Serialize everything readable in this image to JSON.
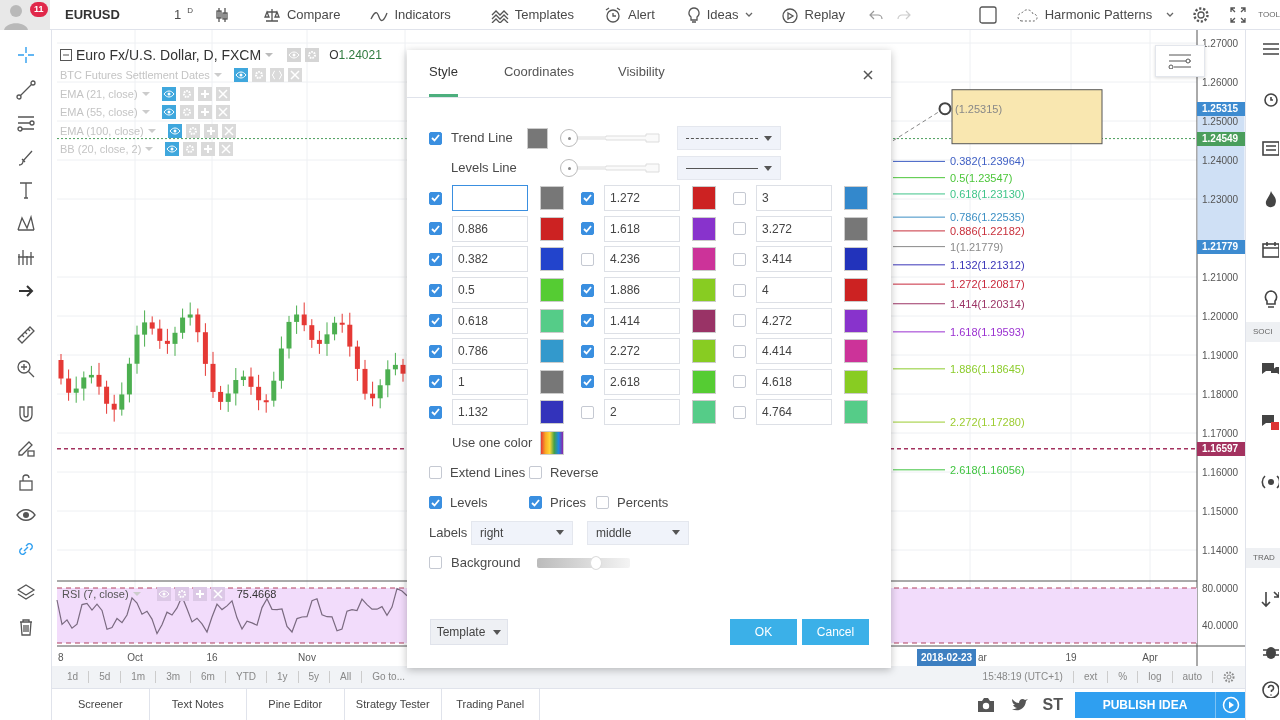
{
  "top_bar": {
    "notification_count": "11",
    "symbol": "EURUSD",
    "interval": "1",
    "interval_unit": "D",
    "buttons": [
      {
        "label": "Compare",
        "kind": "compare"
      },
      {
        "label": "Indicators",
        "kind": "indicators"
      },
      {
        "label": "Templates",
        "kind": "templates"
      },
      {
        "label": "Alert",
        "kind": "alert"
      },
      {
        "label": "Ideas",
        "kind": "ideas"
      },
      {
        "label": "Replay",
        "kind": "replay"
      }
    ],
    "layout_name": "Harmonic Patterns",
    "edge_label": "TOOL"
  },
  "chart": {
    "title": "Euro Fx/U.S. Dollar, D, FXCM",
    "open_label": "O",
    "open_value": "1.24021",
    "studies": [
      {
        "label": "BTC Futures Settlement Dates",
        "kind": "event"
      },
      {
        "label": "EMA (21, close)",
        "kind": "study"
      },
      {
        "label": "EMA (55, close)",
        "kind": "study"
      },
      {
        "label": "EMA (100, close)",
        "kind": "study"
      },
      {
        "label": "BB (20, close, 2)",
        "kind": "study"
      }
    ],
    "price_scale": [
      "1.27000",
      "1.26000",
      "1.25000",
      "1.24000",
      "1.23000",
      "1.21000",
      "1.20000",
      "1.19000",
      "1.18000",
      "1.17000",
      "1.16000",
      "1.15000",
      "1.14000"
    ],
    "price_tags": [
      {
        "text": "1.25315",
        "color": "#3d8bd0"
      },
      {
        "text": "1.24549",
        "color": "#4a9e5c"
      },
      {
        "text": "1.21779",
        "color": "#3d8bd0"
      },
      {
        "text": "1.16597",
        "color": "#a3325f"
      }
    ],
    "anchor_label": "(1.25315)",
    "fib_labels": [
      {
        "text": "0.382(1.23964)",
        "color": "#3f5fc4"
      },
      {
        "text": "0.5(1.23547)",
        "color": "#4cc63a"
      },
      {
        "text": "0.618(1.23130)",
        "color": "#3fc48a"
      },
      {
        "text": "0.786(1.22535)",
        "color": "#3c8fc4"
      },
      {
        "text": "0.886(1.22182)",
        "color": "#c8303c"
      },
      {
        "text": "1(1.21779)",
        "color": "#8a8a8a"
      },
      {
        "text": "1.132(1.21312)",
        "color": "#3a35b8"
      },
      {
        "text": "1.272(1.20817)",
        "color": "#c8283c"
      },
      {
        "text": "1.414(1.20314)",
        "color": "#9c3566"
      },
      {
        "text": "1.618(1.19593)",
        "color": "#9a30d0"
      },
      {
        "text": "1.886(1.18645)",
        "color": "#8ccc2c"
      },
      {
        "text": "2.272(1.17280)",
        "color": "#9ccc30"
      },
      {
        "text": "2.618(1.16056)",
        "color": "#3fc43f"
      }
    ],
    "rsi": {
      "title": "RSI (7, close)",
      "value": "75.4668",
      "scale": [
        "80.0000",
        "40.0000"
      ]
    },
    "time_scale": [
      "8",
      "Oct",
      "16",
      "Nov",
      "ar",
      "19",
      "Apr"
    ],
    "crosshair_date": "2018-02-23"
  },
  "range_bar": {
    "ranges": [
      "1d",
      "5d",
      "1m",
      "3m",
      "6m",
      "YTD",
      "1y",
      "5y",
      "All"
    ],
    "goto": "Go to...",
    "clock": "15:48:19 (UTC+1)",
    "options": [
      "ext",
      "%",
      "log",
      "auto"
    ]
  },
  "bottom_bar": {
    "tabs": [
      "Screener",
      "Text Notes",
      "Pine Editor",
      "Strategy Tester",
      "Trading Panel"
    ],
    "share_label": "ST",
    "publish": "PUBLISH IDEA"
  },
  "right_sidebar": {
    "section_labels": [
      "SOCI",
      "TRAD"
    ]
  },
  "dialog": {
    "tabs": [
      {
        "label": "Style",
        "selected": true
      },
      {
        "label": "Coordinates",
        "selected": false
      },
      {
        "label": "Visibility",
        "selected": false
      }
    ],
    "trend_line": {
      "label": "Trend Line",
      "checked": true,
      "color": "#777777",
      "dashed": true
    },
    "levels_line": {
      "label": "Levels Line",
      "dashed": false
    },
    "levels": [
      {
        "checked": true,
        "color": "#777777"
      },
      {
        "value": "0.886",
        "checked": true,
        "color": "#cc2222"
      },
      {
        "value": "0.382",
        "checked": true,
        "color": "#2244cc"
      },
      {
        "value": "0.5",
        "checked": true,
        "color": "#55cc33"
      },
      {
        "value": "0.618",
        "checked": true,
        "color": "#55cc88"
      },
      {
        "value": "0.786",
        "checked": true,
        "color": "#3399cc"
      },
      {
        "value": "1",
        "checked": true,
        "color": "#777777"
      },
      {
        "value": "1.132",
        "checked": true,
        "color": "#3333bb"
      },
      {
        "value": "1.272",
        "checked": true,
        "color": "#cc2222"
      },
      {
        "value": "1.618",
        "checked": true,
        "color": "#8833cc"
      },
      {
        "value": "4.236",
        "checked": false,
        "color": "#cc3399"
      },
      {
        "value": "1.886",
        "checked": true,
        "color": "#88cc22"
      },
      {
        "value": "1.414",
        "checked": true,
        "color": "#993366"
      },
      {
        "value": "2.272",
        "checked": true,
        "color": "#88cc22"
      },
      {
        "value": "2.618",
        "checked": true,
        "color": "#55cc33"
      },
      {
        "value": "2",
        "checked": false,
        "color": "#55cc88"
      },
      {
        "value": "3",
        "checked": false,
        "color": "#3388cc"
      },
      {
        "value": "3.272",
        "checked": false,
        "color": "#777777"
      },
      {
        "value": "3.414",
        "checked": false,
        "color": "#2233bb"
      },
      {
        "value": "4",
        "checked": false,
        "color": "#cc2222"
      },
      {
        "value": "4.272",
        "checked": false,
        "color": "#8833cc"
      },
      {
        "value": "4.414",
        "checked": false,
        "color": "#cc3399"
      },
      {
        "value": "4.618",
        "checked": false,
        "color": "#88cc22"
      },
      {
        "value": "4.764",
        "checked": false,
        "color": "#55cc88"
      }
    ],
    "one_color": {
      "label": "Use one color"
    },
    "option_rows": [
      [
        {
          "label": "Extend Lines",
          "checked": false
        },
        {
          "label": "Reverse",
          "checked": false
        }
      ],
      [
        {
          "label": "Levels",
          "checked": true
        },
        {
          "label": "Prices",
          "checked": true
        },
        {
          "label": "Percents",
          "checked": false
        }
      ]
    ],
    "labels_row": {
      "label": "Labels",
      "horizontal": "right",
      "vertical": "middle"
    },
    "background": {
      "label": "Background",
      "checked": false,
      "level": 0.65
    },
    "template": "Template",
    "ok": "OK",
    "cancel": "Cancel"
  }
}
